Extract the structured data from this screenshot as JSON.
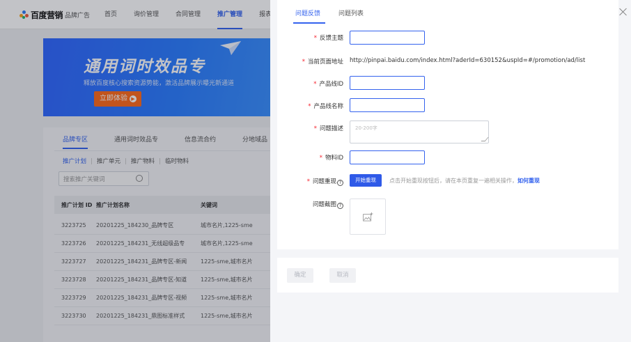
{
  "app": {
    "brand": "百度营销",
    "brand_sub": "品牌广告",
    "nav": [
      "首页",
      "询价管理",
      "合同管理",
      "推广管理",
      "报表"
    ],
    "nav_active_index": 3
  },
  "banner": {
    "title": "通用词时效品专",
    "subtitle": "释放百度核心搜索资源势能，激活品牌展示曝光新通道",
    "cta": "立即体验"
  },
  "content": {
    "tabs": [
      "品牌专区",
      "通用词时效品专",
      "信息流合约",
      "分地域品"
    ],
    "subtabs": [
      "推广计划",
      "推广单元",
      "推广物料",
      "临时物料"
    ],
    "search_placeholder": "搜索推广关键词",
    "table": {
      "headers": [
        "推广计划 ID",
        "推广计划名称",
        "关键词"
      ],
      "rows": [
        [
          "3223725",
          "20201225_184230_品牌专区",
          "城市名片,1225-sme"
        ],
        [
          "3223726",
          "20201225_184231_无线超级品专",
          "城市名片,1225-sme"
        ],
        [
          "3223727",
          "20201225_184231_品牌专区-新闻",
          "1225-sme,城市名片"
        ],
        [
          "3223728",
          "20201225_184231_品牌专区-知道",
          "1225-sme,城市名片"
        ],
        [
          "3223729",
          "20201225_184231_品牌专区-视频",
          "1225-sme,城市名片"
        ],
        [
          "3223730",
          "20201225_184231_鼎图标准样式",
          "1225-sme,城市名片"
        ]
      ]
    }
  },
  "drawer": {
    "tabs": [
      "问题反馈",
      "问题列表"
    ],
    "active_tab_index": 0,
    "form": {
      "subject_label": "反馈主题",
      "page_url_label": "当前页面地址",
      "page_url_value": "http://pinpai.baidu.com/index.html?aderId=630152&uspId=#/promotion/ad/list",
      "product_id_label": "产品线ID",
      "product_name_label": "产品线名称",
      "desc_label": "问题描述",
      "desc_placeholder": "20-200字",
      "material_id_label": "物料ID",
      "repro_label": "问题重现",
      "repro_button": "开始重现",
      "repro_hint": "点击开始重现按钮后，请在本页重复一遍相关操作，",
      "repro_link": "如何重现",
      "screenshot_label": "问题截图",
      "required_mark": "*",
      "help_icon": "?"
    },
    "footer": {
      "ok": "确定",
      "cancel": "取消"
    }
  },
  "colors": {
    "accent": "#3362ee",
    "banner_cta": "#ff6a1a",
    "required": "#f5222d"
  }
}
